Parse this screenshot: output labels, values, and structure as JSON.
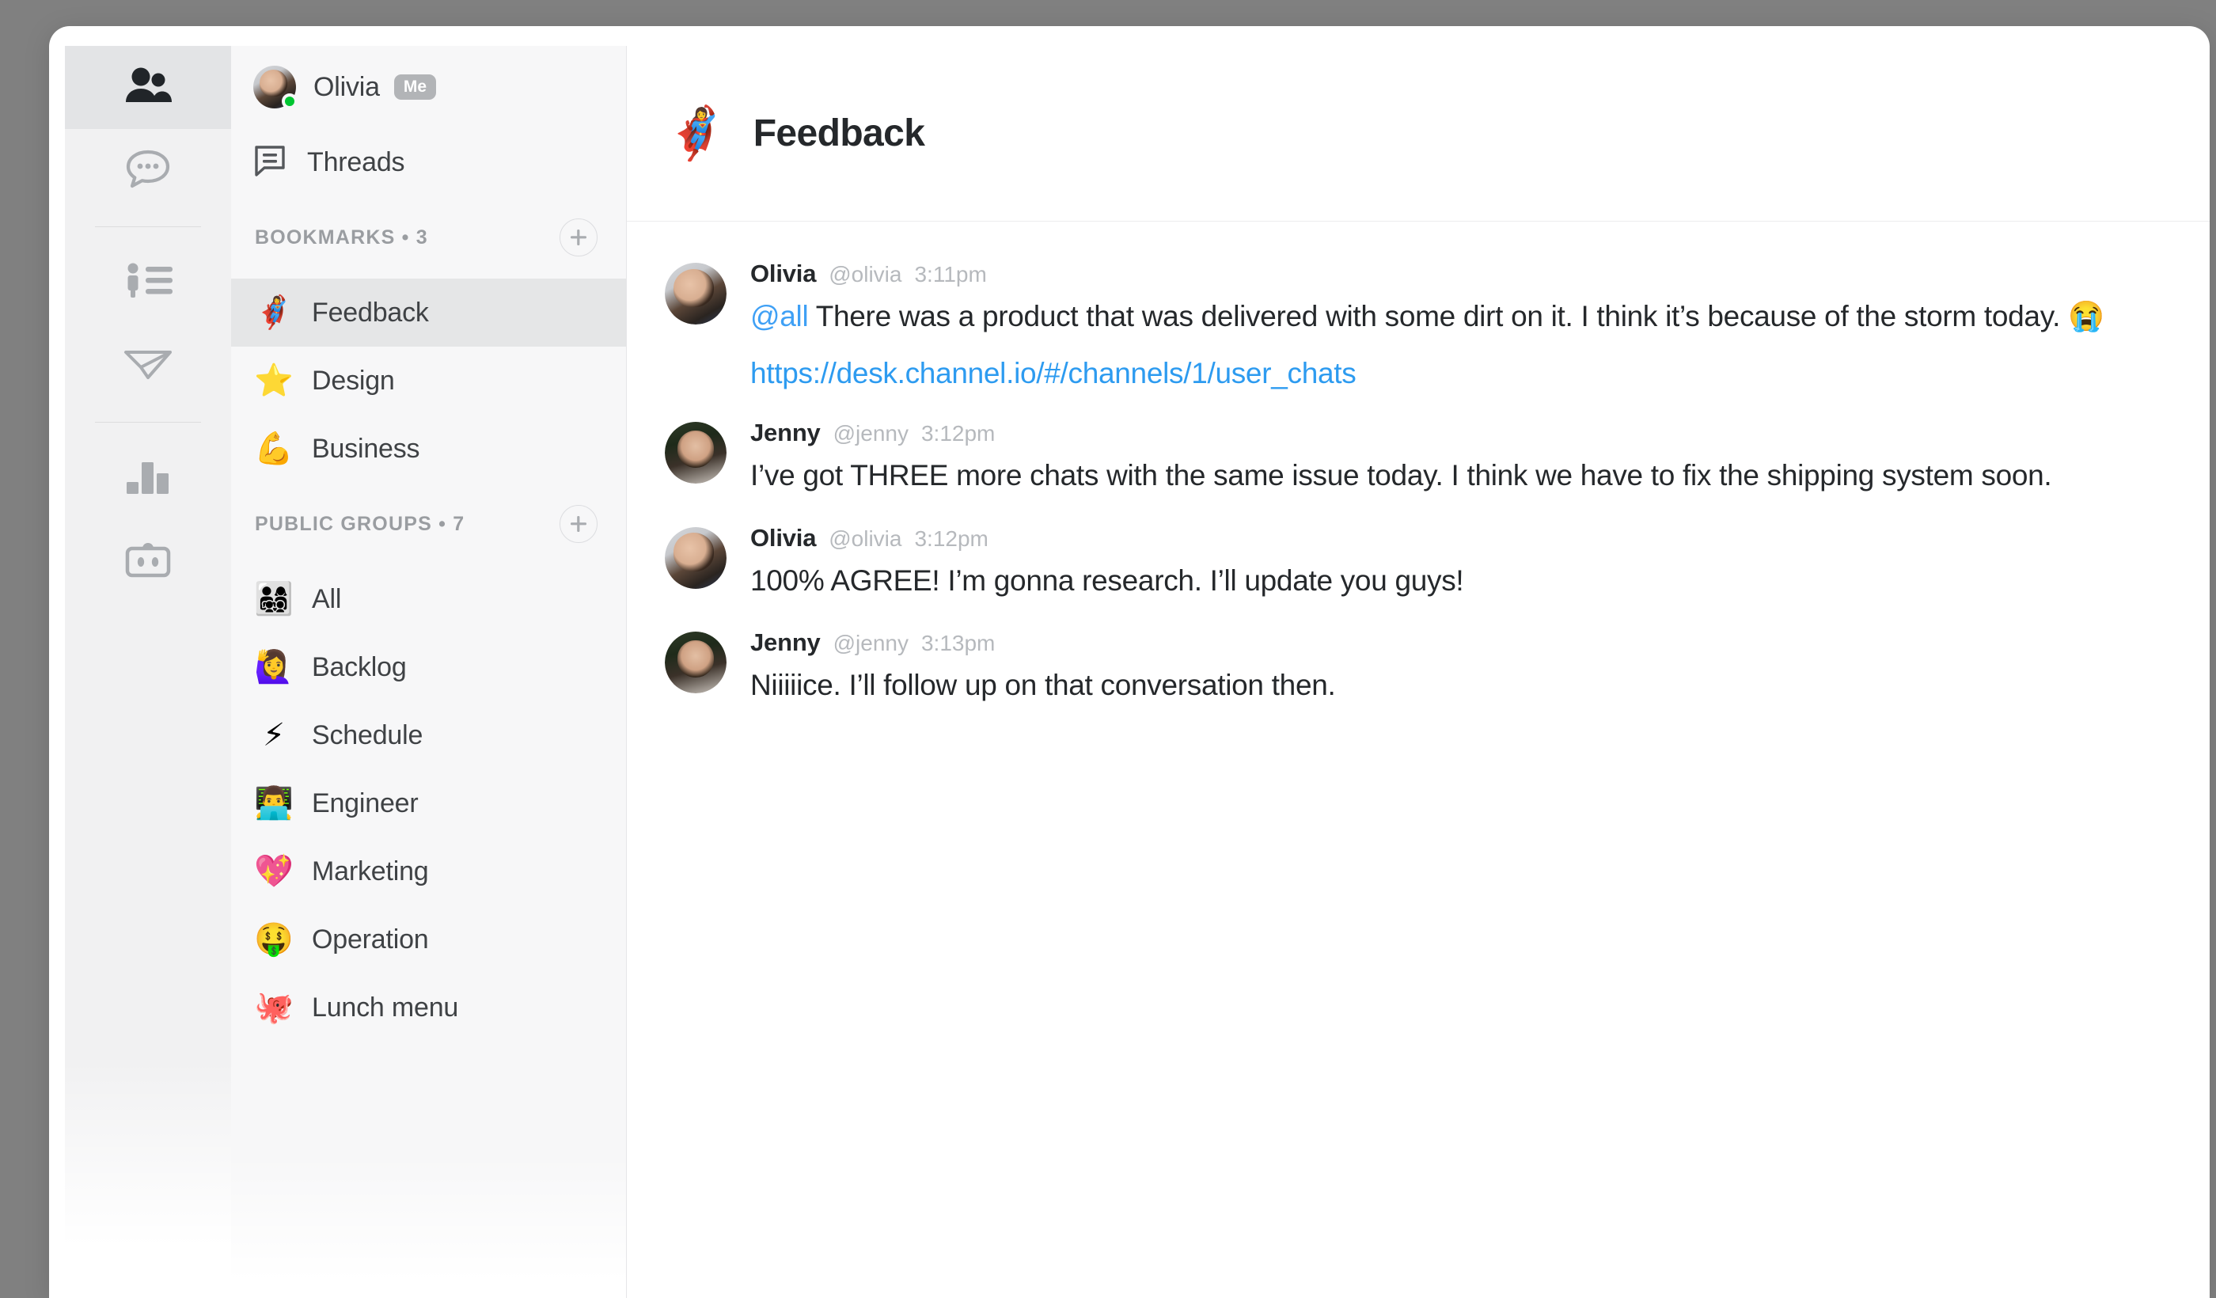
{
  "rail": {
    "items": [
      {
        "name": "team-icon",
        "label": "Team",
        "active": true
      },
      {
        "name": "chat-icon",
        "label": "Chats",
        "active": false
      },
      {
        "name": "directory-icon",
        "label": "Directory",
        "active": false
      },
      {
        "name": "send-icon",
        "label": "Send",
        "active": false
      },
      {
        "name": "stats-icon",
        "label": "Statistics",
        "active": false
      },
      {
        "name": "bot-icon",
        "label": "Bot",
        "active": false
      }
    ]
  },
  "sidebar": {
    "me": {
      "name": "Olivia",
      "badge": "Me",
      "status": "online",
      "status_color": "#00c531"
    },
    "threads": {
      "label": "Threads"
    },
    "bookmarks": {
      "title": "BOOKMARKS • 3",
      "add_label": "+",
      "items": [
        {
          "emoji": "🦸‍♀️",
          "label": "Feedback",
          "selected": true
        },
        {
          "emoji": "⭐",
          "label": "Design",
          "selected": false
        },
        {
          "emoji": "💪",
          "label": "Business",
          "selected": false
        }
      ]
    },
    "public_groups": {
      "title": "PUBLIC GROUPS • 7",
      "add_label": "+",
      "items": [
        {
          "emoji": "👨‍👩‍👧‍👦",
          "label": "All"
        },
        {
          "emoji": "🙋‍♀️",
          "label": "Backlog"
        },
        {
          "emoji": "⚡",
          "label": "Schedule"
        },
        {
          "emoji": "👨‍💻",
          "label": "Engineer"
        },
        {
          "emoji": "💖",
          "label": "Marketing"
        },
        {
          "emoji": "🤑",
          "label": "Operation"
        },
        {
          "emoji": "🐙",
          "label": "Lunch menu"
        }
      ]
    }
  },
  "chat": {
    "header": {
      "emoji": "🦸‍♀️",
      "title": "Feedback"
    },
    "messages": [
      {
        "author": "Olivia",
        "handle": "@olivia",
        "time": "3:11pm",
        "avatar": "olivia",
        "mention": "@all",
        "text": " There was a product that was delivered with some dirt on it. I think it’s because of the storm today. 😭",
        "link": "https://desk.channel.io/#/channels/1/user_chats"
      },
      {
        "author": "Jenny",
        "handle": "@jenny",
        "time": "3:12pm",
        "avatar": "jenny",
        "mention": "",
        "text": "I’ve got THREE more chats with the same issue today. I think we have to fix the shipping system soon.",
        "link": ""
      },
      {
        "author": "Olivia",
        "handle": "@olivia",
        "time": "3:12pm",
        "avatar": "olivia",
        "mention": "",
        "text": "100% AGREE! I’m gonna research. I’ll update you guys!",
        "link": ""
      },
      {
        "author": "Jenny",
        "handle": "@jenny",
        "time": "3:13pm",
        "avatar": "jenny",
        "mention": "",
        "text": "Niiiiice. I’ll follow up on that conversation then.",
        "link": ""
      }
    ]
  },
  "colors": {
    "accent_link": "#2d9bf0",
    "mention": "#3fa0f5",
    "selected_row": "#e5e6e7",
    "sidebar_bg": "#f7f7f8",
    "rail_bg": "#f1f1f2"
  }
}
